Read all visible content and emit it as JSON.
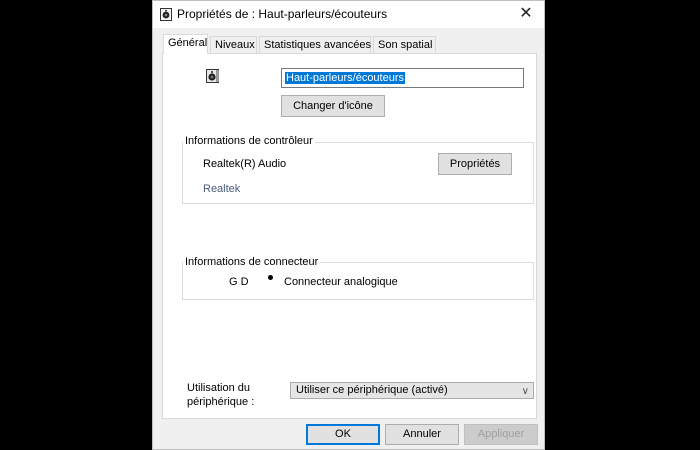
{
  "window": {
    "title": "Propriétés de : Haut-parleurs/écouteurs",
    "close_glyph": "✕",
    "title_icon": "speaker-icon"
  },
  "tabs": [
    {
      "label": "Général",
      "active": true
    },
    {
      "label": "Niveaux",
      "active": false
    },
    {
      "label": "Statistiques avancées",
      "active": false
    },
    {
      "label": "Son spatial",
      "active": false
    }
  ],
  "general": {
    "device_icon": "speaker-icon",
    "name_value": "Haut-parleurs/écouteurs",
    "change_icon_label": "Changer d'icône"
  },
  "controller": {
    "group_label": "Informations de contrôleur",
    "name": "Realtek(R) Audio",
    "vendor": "Realtek",
    "properties_label": "Propriétés"
  },
  "connector": {
    "group_label": "Informations de connecteur",
    "channels": "G D",
    "description": "Connecteur analogique"
  },
  "usage": {
    "label": "Utilisation du périphérique :",
    "selected": "Utiliser ce périphérique (activé)"
  },
  "footer": {
    "ok_label": "OK",
    "cancel_label": "Annuler",
    "apply_label": "Appliquer"
  }
}
